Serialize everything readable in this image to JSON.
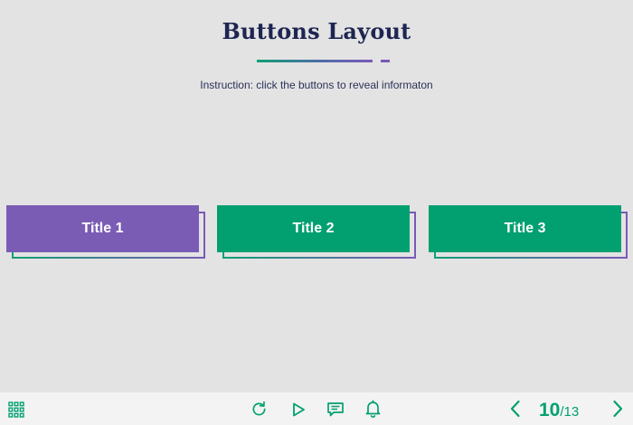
{
  "slide": {
    "title": "Buttons Layout",
    "instruction": "Instruction: click the buttons to reveal informaton",
    "buttons": [
      {
        "label": "Title 1",
        "state": "active"
      },
      {
        "label": "Title 2",
        "state": "default"
      },
      {
        "label": "Title 3",
        "state": "default"
      }
    ]
  },
  "bottom_bar": {
    "icons": [
      "grid-menu-icon",
      "replay-icon",
      "play-icon",
      "transcript-icon",
      "notification-bell-icon",
      "previous-arrow-icon",
      "next-arrow-icon"
    ],
    "page": {
      "current": "10",
      "separator": "/",
      "total": "13"
    }
  },
  "colors": {
    "accent_green": "#02a070",
    "accent_purple": "#7a5cb5",
    "title_navy": "#1e2551",
    "background": "#e3e3e3",
    "bar_background": "#f3f3f3"
  }
}
